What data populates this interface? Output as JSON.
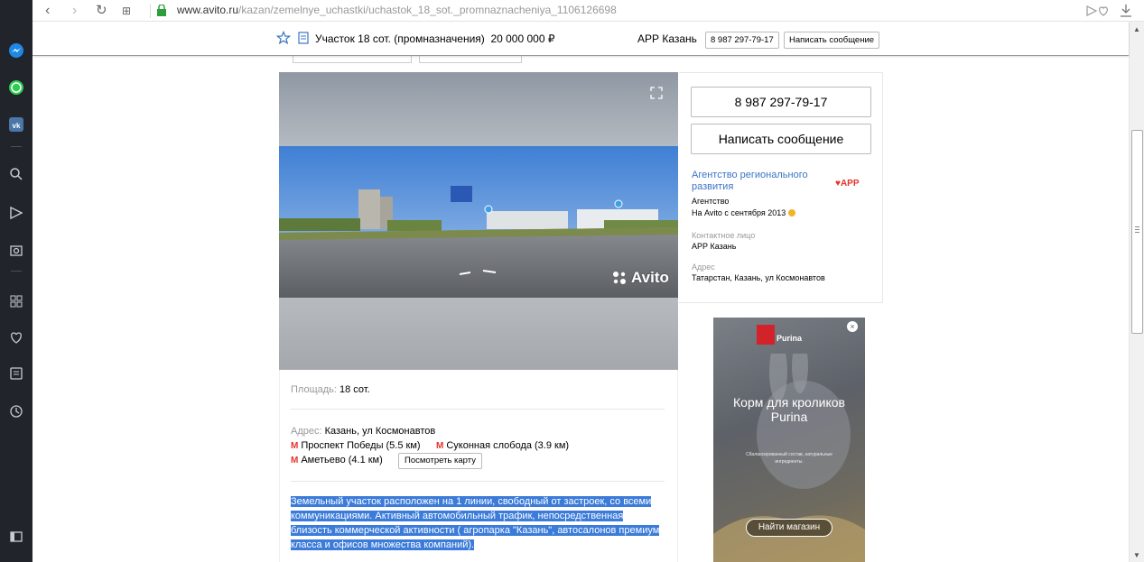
{
  "browser": {
    "url_domain": "www.avito.ru",
    "url_path": "/kazan/zemelnye_uchastki/uchastok_18_sot._promnaznacheniya_1106126698"
  },
  "header": {
    "title": "Участок 18 сот. (промназначения)",
    "price": "20 000 000 ₽",
    "seller": "АРР Казань",
    "phone_button": "8 987 297-79-17",
    "message_button": "Написать сообщение"
  },
  "photo": {
    "watermark": "Avito"
  },
  "details": {
    "area_label": "Площадь:",
    "area_value": "18 сот.",
    "address_label": "Адрес:",
    "address_value": "Казань, ул Космонавтов",
    "metro": [
      {
        "name": "Проспект Победы",
        "dist": "(5.5 км)"
      },
      {
        "name": "Суконная слобода",
        "dist": "(3.9 км)"
      },
      {
        "name": "Аметьево",
        "dist": "(4.1 км)"
      }
    ],
    "metro_icon": "М",
    "map_button": "Посмотреть карту",
    "description": "Земельный участок расположен на 1 линии, свободный от застроек, со всеми коммуникациями. Активный автомобильный трафик, непосредственная близость коммерческой активности ( агропарка \"Казань\", автосалонов премиум класса и офисов множества компаний)."
  },
  "seller_card": {
    "phone": "8 987 297-79-17",
    "message": "Написать сообщение",
    "agency_name": "Агентство регионального развития",
    "agency_logo": "APP",
    "agency_type": "Агентство",
    "since": "На Avito с сентября 2013",
    "contact_label": "Контактное лицо",
    "contact_value": "АРР Казань",
    "address_label": "Адрес",
    "address_value": "Татарстан, Казань, ул Космонавтов"
  },
  "ad": {
    "brand": "Purina",
    "headline": "Корм для кроликов Purina",
    "fineprint": "Сбалансированный состав, натуральные ингредиенты.",
    "button": "Найти магазин",
    "close": "×"
  },
  "colors": {
    "link": "#3b74c4",
    "selection": "#3b7bd9",
    "metro_red": "#e5322d",
    "sidebar": "#21252b"
  }
}
